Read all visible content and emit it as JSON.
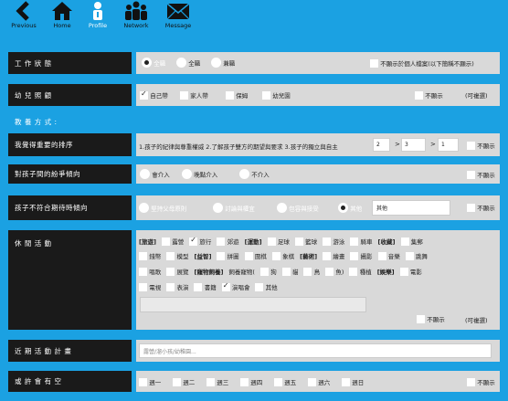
{
  "nav": {
    "items": [
      {
        "label": "Previous",
        "icon": "back-arrow-icon"
      },
      {
        "label": "Home",
        "icon": "home-icon"
      },
      {
        "label": "Profile",
        "icon": "person-icon",
        "active": true
      },
      {
        "label": "Network",
        "icon": "group-icon"
      },
      {
        "label": "Message",
        "icon": "envelope-icon"
      }
    ],
    "active_color": "#ffffff"
  },
  "colors": {
    "background": "#1ba1e2",
    "label_bg": "#1a1a1a",
    "content_bg": "#d9d9d9"
  },
  "work_status": {
    "label": "工 作 狀 態",
    "options": [
      "全職",
      "全職",
      "兼職"
    ],
    "selected_index": 0,
    "hide_label": "不顯示於個人檔案(以下簡稱不顯示)"
  },
  "childcare": {
    "label": "幼 兒 照 顧",
    "options": [
      "自己帶",
      "家人帶",
      "保姆",
      "幼兒園"
    ],
    "checked": [
      true,
      false,
      false,
      false
    ],
    "hide_label": "不顯示",
    "multi_note": "(可複選)"
  },
  "education_header": "教 養 方 式 :",
  "priority": {
    "label": "我覺得重要的排序",
    "text": "1.孩子的紀律與尊重權威 2.了解孩子雙方的期望與要求 3.孩子的獨立與自主",
    "values": [
      "2",
      "3",
      "1"
    ],
    "sep": ">",
    "hide_label": "不顯示"
  },
  "dispute": {
    "label": "對孩子間的紛爭傾向",
    "options": [
      "會介入",
      "晚點介入",
      "不介入"
    ],
    "selected_index": -1,
    "hide_label": "不顯示"
  },
  "unmet": {
    "label": "孩子不符合期待時傾向",
    "options": [
      "堅持父母原則",
      "討論與權宜",
      "包容與接受",
      "其他"
    ],
    "selected_index": 3,
    "other_value": "其他",
    "hide_label": "不顯示"
  },
  "leisure": {
    "label": "休 閒 活 動",
    "line1": [
      {
        "cat": "[旅遊]"
      },
      {
        "cb": false,
        "t": "露營"
      },
      {
        "cb": true,
        "t": "旅行"
      },
      {
        "cb": false,
        "t": "郊遊"
      },
      {
        "cat": "[運動]"
      },
      {
        "cb": false,
        "t": "足球"
      },
      {
        "cb": false,
        "t": "籃球"
      },
      {
        "cb": false,
        "t": "游泳"
      },
      {
        "cb": false,
        "t": "騎車"
      },
      {
        "cat": "[收藏]"
      },
      {
        "cb": false,
        "t": "集郵"
      }
    ],
    "line2": [
      {
        "cb": false,
        "t": "錢幣"
      },
      {
        "cb": false,
        "t": "模型"
      },
      {
        "cat": "[益智]"
      },
      {
        "cb": false,
        "t": "拼圖"
      },
      {
        "cb": false,
        "t": "圍棋"
      },
      {
        "cb": false,
        "t": "象棋"
      },
      {
        "cat": "[藝術]"
      },
      {
        "cb": false,
        "t": "繪畫"
      },
      {
        "cb": false,
        "t": "攝影"
      },
      {
        "cb": false,
        "t": "音樂"
      },
      {
        "cb": false,
        "t": "跳舞"
      }
    ],
    "line3": [
      {
        "cb": false,
        "t": "唱歌"
      },
      {
        "cb": false,
        "t": "展覽"
      },
      {
        "cat": "[寵物飼養]"
      },
      {
        "t": "飼養寵物("
      },
      {
        "cb": false,
        "t": "狗"
      },
      {
        "cb": false,
        "t": "貓"
      },
      {
        "cb": false,
        "t": "鳥"
      },
      {
        "cb": false,
        "t": "魚)"
      },
      {
        "cb": false,
        "t": "種植"
      },
      {
        "cat": "[娛樂]"
      },
      {
        "cb": false,
        "t": "電影"
      }
    ],
    "line4": [
      {
        "cb": false,
        "t": "電視"
      },
      {
        "cb": false,
        "t": "表演"
      },
      {
        "cb": false,
        "t": "書籍"
      },
      {
        "cb": true,
        "t": "演唱會"
      },
      {
        "cb": false,
        "t": "其他"
      }
    ],
    "hide_label": "不顯示",
    "multi_note": "(可複選)"
  },
  "recent": {
    "label": "近 期 活 動 計 畫",
    "placeholder": "露營/溜小孩/幼稚園..."
  },
  "free": {
    "label": "或 許 會 有 空",
    "days": [
      "週一",
      "週二",
      "週三",
      "週四",
      "週五",
      "週六",
      "週日"
    ],
    "hide_label": "不顯示"
  }
}
